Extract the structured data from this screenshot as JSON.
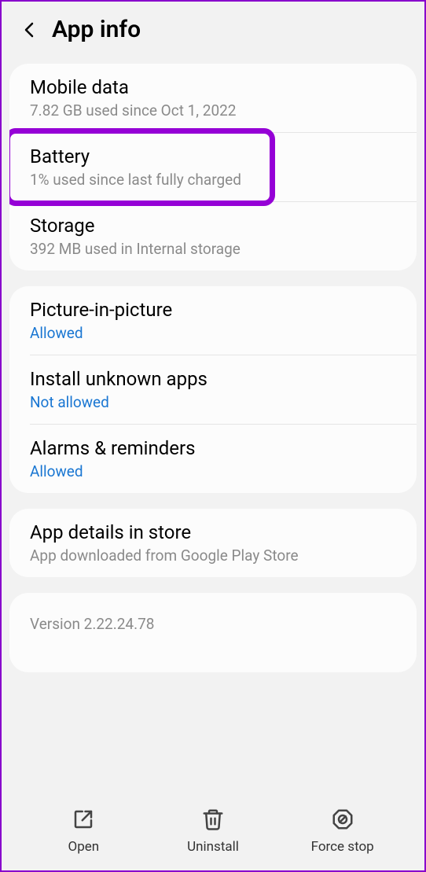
{
  "header": {
    "title": "App info"
  },
  "groups": {
    "usage": {
      "mobile_data": {
        "title": "Mobile data",
        "subtitle": "7.82 GB used since Oct 1, 2022"
      },
      "battery": {
        "title": "Battery",
        "subtitle": "1% used since last fully charged"
      },
      "storage": {
        "title": "Storage",
        "subtitle": "392 MB used in Internal storage"
      }
    },
    "permissions": {
      "pip": {
        "title": "Picture-in-picture",
        "status": "Allowed"
      },
      "install_unknown": {
        "title": "Install unknown apps",
        "status": "Not allowed"
      },
      "alarms": {
        "title": "Alarms & reminders",
        "status": "Allowed"
      }
    },
    "store": {
      "title": "App details in store",
      "subtitle": "App downloaded from Google Play Store"
    },
    "version": "Version 2.22.24.78"
  },
  "bottom_bar": {
    "open": "Open",
    "uninstall": "Uninstall",
    "force_stop": "Force stop"
  }
}
